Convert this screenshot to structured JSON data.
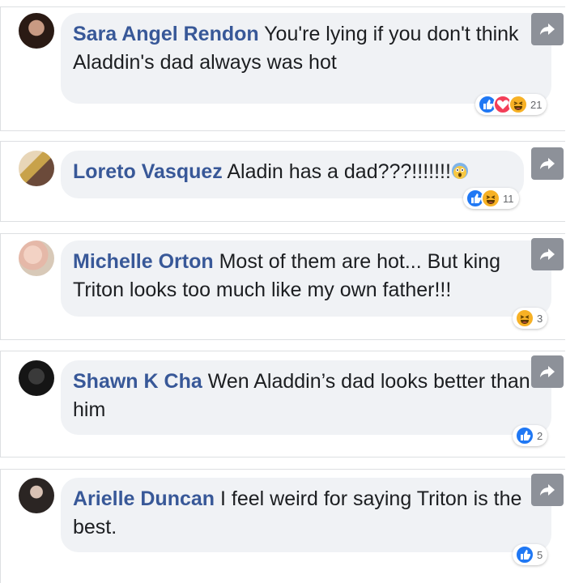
{
  "comments": [
    {
      "author": "Sara Angel Rendon",
      "text": "You're lying if you don't think Aladdin's dad always was hot",
      "reaction_count": "21",
      "reactions": [
        "like-icon",
        "love-icon",
        "haha-icon"
      ]
    },
    {
      "author": "Loreto Vasquez",
      "text": "Aladin has a dad???!!!!!!!",
      "reaction_count": "11",
      "reactions": [
        "like-icon",
        "haha-icon"
      ],
      "trailing_emoji": "scream-emoji"
    },
    {
      "author": "Michelle Orton",
      "text": "Most of them are hot... But king Triton looks too much like my own father!!!",
      "reaction_count": "3",
      "reactions": [
        "haha-icon"
      ]
    },
    {
      "author": "Shawn K Cha",
      "text": "Wen Aladdin’s dad looks better than him",
      "reaction_count": "2",
      "reactions": [
        "like-icon"
      ]
    },
    {
      "author": "Arielle Duncan",
      "text": "I feel weird for saying Triton is the best.",
      "reaction_count": "5",
      "reactions": [
        "like-icon"
      ]
    }
  ],
  "colors": {
    "author": "#385898",
    "bubble": "#f0f2f5",
    "like": "#2078f4",
    "love": "#f33e58",
    "haha": "#f7b125",
    "share": "#8d9199"
  }
}
